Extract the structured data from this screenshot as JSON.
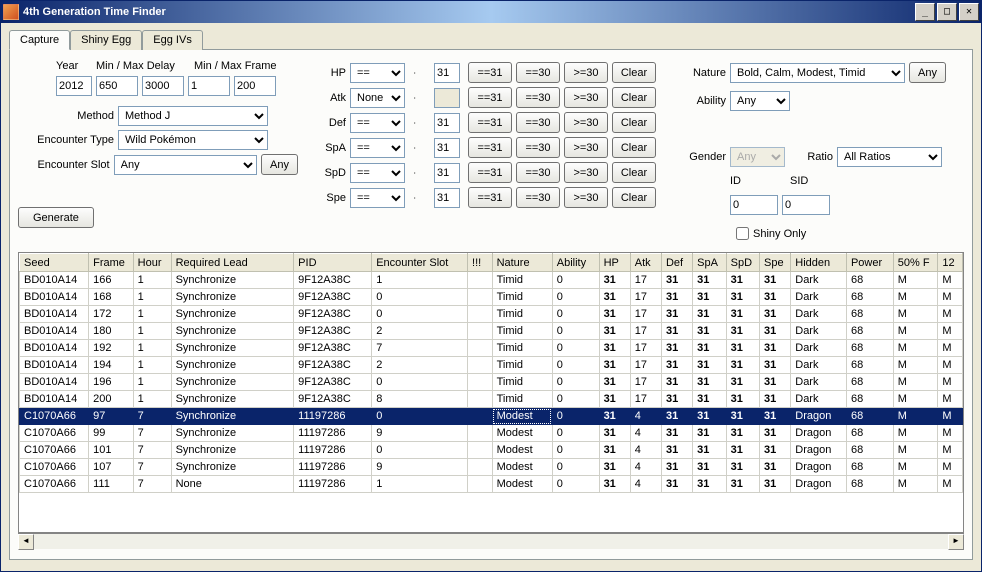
{
  "window": {
    "title": "4th Generation Time Finder"
  },
  "tabs": [
    "Capture",
    "Shiny Egg",
    "Egg IVs"
  ],
  "activeTab": 0,
  "inputs": {
    "yearLabel": "Year",
    "minMaxDelayLabel": "Min / Max Delay",
    "minMaxFrameLabel": "Min / Max Frame",
    "year": "2012",
    "minDelay": "650",
    "maxDelay": "3000",
    "minFrame": "1",
    "maxFrame": "200",
    "methodLabel": "Method",
    "method": "Method J",
    "encTypeLabel": "Encounter Type",
    "encType": "Wild Pokémon",
    "encSlotLabel": "Encounter Slot",
    "encSlot": "Any",
    "anyBtn": "Any",
    "generateBtn": "Generate"
  },
  "stats": {
    "labels": {
      "hp": "HP",
      "atk": "Atk",
      "def": "Def",
      "spa": "SpA",
      "spd": "SpD",
      "spe": "Spe"
    },
    "ops": {
      "eq": "==",
      "none": "None"
    },
    "val31": "31",
    "btns": {
      "e31": "==31",
      "e30": "==30",
      "ge30": ">=30",
      "clear": "Clear"
    },
    "hpOp": "==",
    "atkOp": "None",
    "defOp": "==",
    "spaOp": "==",
    "spdOp": "==",
    "speOp": "==",
    "hpVal": "31",
    "atkVal": "",
    "defVal": "31",
    "spaVal": "31",
    "spdVal": "31",
    "speVal": "31"
  },
  "right": {
    "natureLabel": "Nature",
    "nature": "Bold, Calm, Modest, Timid",
    "anyBtn": "Any",
    "abilityLabel": "Ability",
    "ability": "Any",
    "genderLabel": "Gender",
    "gender": "Any",
    "ratioLabel": "Ratio",
    "ratio": "All Ratios",
    "idLabel": "ID",
    "id": "0",
    "sidLabel": "SID",
    "sid": "0",
    "shinyOnly": "Shiny Only"
  },
  "table": {
    "headers": [
      "Seed",
      "Frame",
      "Hour",
      "Required Lead",
      "PID",
      "Encounter Slot",
      "!!!",
      "Nature",
      "Ability",
      "HP",
      "Atk",
      "Def",
      "SpA",
      "SpD",
      "Spe",
      "Hidden",
      "Power",
      "50% F",
      "12"
    ],
    "widths": [
      62,
      40,
      34,
      110,
      70,
      86,
      22,
      54,
      42,
      28,
      28,
      28,
      30,
      30,
      28,
      50,
      42,
      40,
      22
    ],
    "boldCols": [
      9,
      11,
      12,
      13,
      14
    ],
    "selectedRow": 8,
    "rows": [
      [
        "BD010A14",
        "166",
        "1",
        "Synchronize",
        "9F12A38C",
        "1",
        "",
        "Timid",
        "0",
        "31",
        "17",
        "31",
        "31",
        "31",
        "31",
        "Dark",
        "68",
        "M",
        "M"
      ],
      [
        "BD010A14",
        "168",
        "1",
        "Synchronize",
        "9F12A38C",
        "0",
        "",
        "Timid",
        "0",
        "31",
        "17",
        "31",
        "31",
        "31",
        "31",
        "Dark",
        "68",
        "M",
        "M"
      ],
      [
        "BD010A14",
        "172",
        "1",
        "Synchronize",
        "9F12A38C",
        "0",
        "",
        "Timid",
        "0",
        "31",
        "17",
        "31",
        "31",
        "31",
        "31",
        "Dark",
        "68",
        "M",
        "M"
      ],
      [
        "BD010A14",
        "180",
        "1",
        "Synchronize",
        "9F12A38C",
        "2",
        "",
        "Timid",
        "0",
        "31",
        "17",
        "31",
        "31",
        "31",
        "31",
        "Dark",
        "68",
        "M",
        "M"
      ],
      [
        "BD010A14",
        "192",
        "1",
        "Synchronize",
        "9F12A38C",
        "7",
        "",
        "Timid",
        "0",
        "31",
        "17",
        "31",
        "31",
        "31",
        "31",
        "Dark",
        "68",
        "M",
        "M"
      ],
      [
        "BD010A14",
        "194",
        "1",
        "Synchronize",
        "9F12A38C",
        "2",
        "",
        "Timid",
        "0",
        "31",
        "17",
        "31",
        "31",
        "31",
        "31",
        "Dark",
        "68",
        "M",
        "M"
      ],
      [
        "BD010A14",
        "196",
        "1",
        "Synchronize",
        "9F12A38C",
        "0",
        "",
        "Timid",
        "0",
        "31",
        "17",
        "31",
        "31",
        "31",
        "31",
        "Dark",
        "68",
        "M",
        "M"
      ],
      [
        "BD010A14",
        "200",
        "1",
        "Synchronize",
        "9F12A38C",
        "8",
        "",
        "Timid",
        "0",
        "31",
        "17",
        "31",
        "31",
        "31",
        "31",
        "Dark",
        "68",
        "M",
        "M"
      ],
      [
        "C1070A66",
        "97",
        "7",
        "Synchronize",
        "11197286",
        "0",
        "",
        "Modest",
        "0",
        "31",
        "4",
        "31",
        "31",
        "31",
        "31",
        "Dragon",
        "68",
        "M",
        "M"
      ],
      [
        "C1070A66",
        "99",
        "7",
        "Synchronize",
        "11197286",
        "9",
        "",
        "Modest",
        "0",
        "31",
        "4",
        "31",
        "31",
        "31",
        "31",
        "Dragon",
        "68",
        "M",
        "M"
      ],
      [
        "C1070A66",
        "101",
        "7",
        "Synchronize",
        "11197286",
        "0",
        "",
        "Modest",
        "0",
        "31",
        "4",
        "31",
        "31",
        "31",
        "31",
        "Dragon",
        "68",
        "M",
        "M"
      ],
      [
        "C1070A66",
        "107",
        "7",
        "Synchronize",
        "11197286",
        "9",
        "",
        "Modest",
        "0",
        "31",
        "4",
        "31",
        "31",
        "31",
        "31",
        "Dragon",
        "68",
        "M",
        "M"
      ],
      [
        "C1070A66",
        "111",
        "7",
        "None",
        "11197286",
        "1",
        "",
        "Modest",
        "0",
        "31",
        "4",
        "31",
        "31",
        "31",
        "31",
        "Dragon",
        "68",
        "M",
        "M"
      ]
    ]
  }
}
